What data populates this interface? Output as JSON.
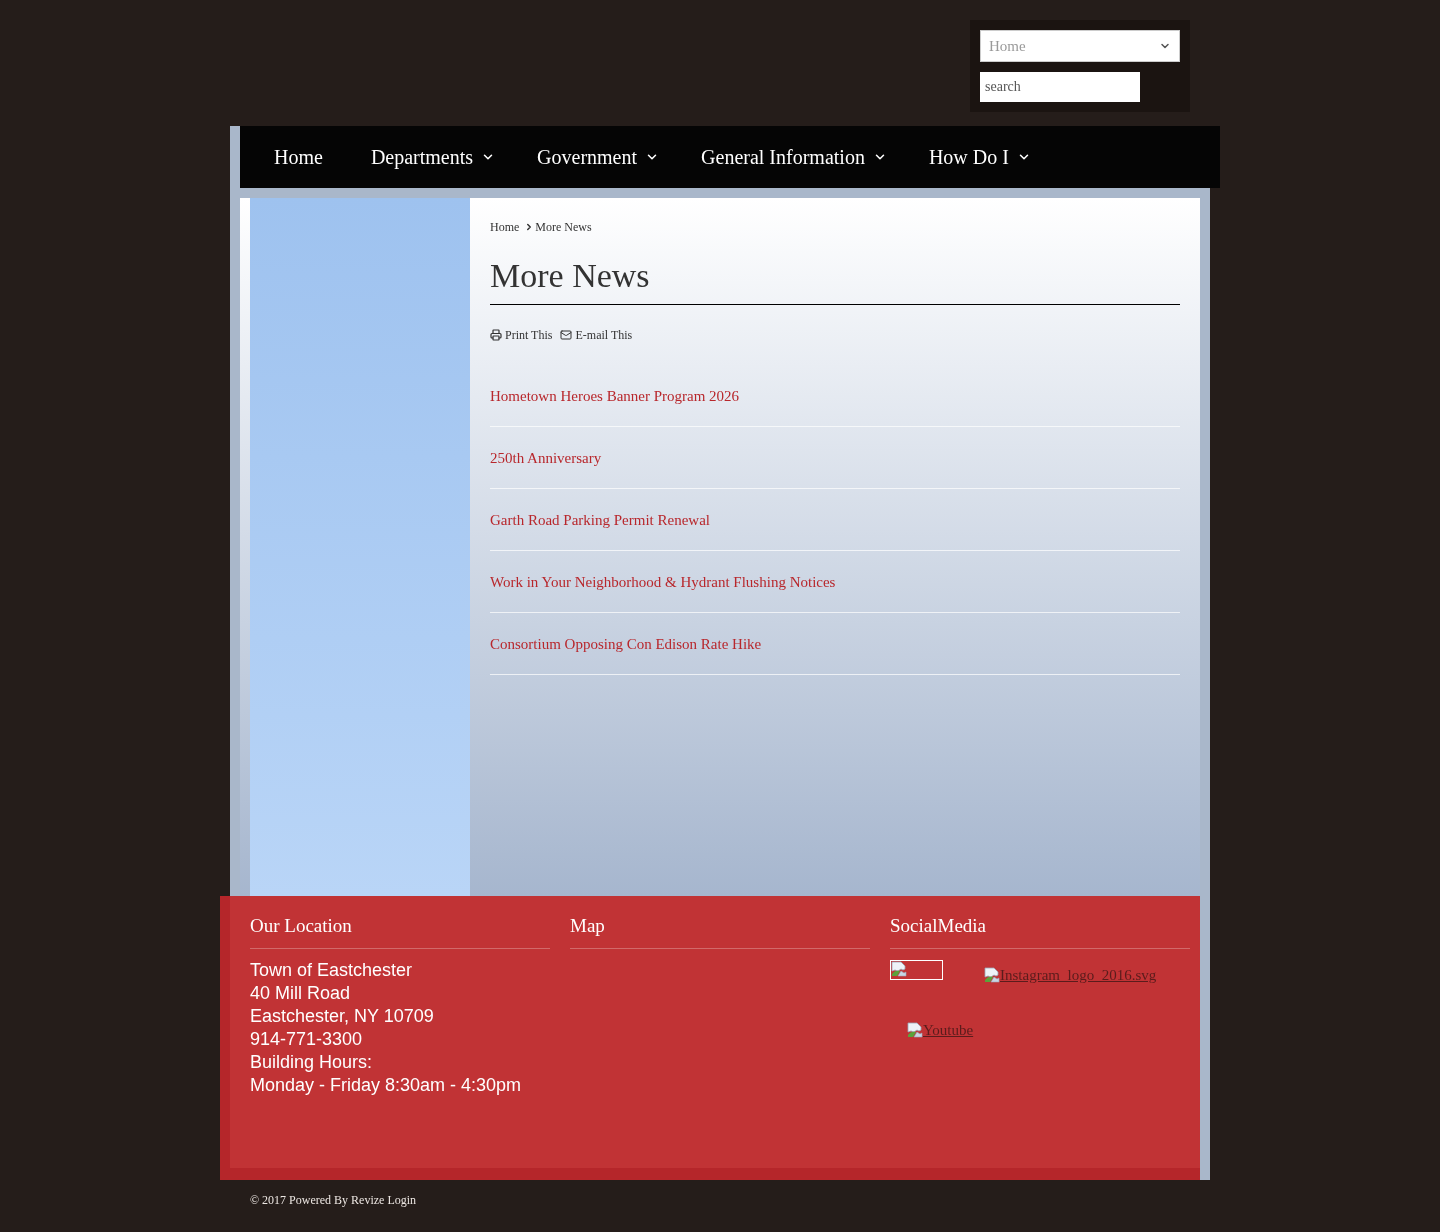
{
  "header": {
    "select": {
      "value": "Home"
    },
    "search": {
      "placeholder": "search"
    }
  },
  "nav": [
    {
      "label": "Home",
      "dropdown": false
    },
    {
      "label": "Departments",
      "dropdown": true
    },
    {
      "label": "Government",
      "dropdown": true
    },
    {
      "label": "General Information",
      "dropdown": true
    },
    {
      "label": "How Do I",
      "dropdown": true
    }
  ],
  "breadcrumb": [
    "Home",
    "More News"
  ],
  "page_title": "More News",
  "tools": [
    {
      "kind": "print",
      "label": "Print This"
    },
    {
      "kind": "email",
      "label": "E-mail This"
    }
  ],
  "news": [
    "Hometown Heroes Banner Program 2026",
    "250th Anniversary",
    "Garth Road Parking Permit Renewal",
    "Work in Your Neighborhood & Hydrant Flushing Notices",
    "Consortium Opposing Con Edison Rate Hike"
  ],
  "footer": {
    "columns": [
      {
        "kind": "location",
        "title": "Our Location",
        "lines": [
          "Town of Eastchester",
          "40 Mill Road",
          "Eastchester, NY 10709",
          "914-771-3300",
          "Building Hours:",
          "Monday - Friday 8:30am - 4:30pm"
        ]
      },
      {
        "kind": "map",
        "title": "Map"
      },
      {
        "kind": "social",
        "title": "SocialMedia",
        "links": [
          {
            "kind": "image-box"
          },
          {
            "kind": "link",
            "label": "Instagram_logo_2016.svg"
          },
          {
            "kind": "link",
            "label": "Youtube"
          }
        ]
      }
    ]
  },
  "copyright": "© 2017 Powered By Revize Login"
}
